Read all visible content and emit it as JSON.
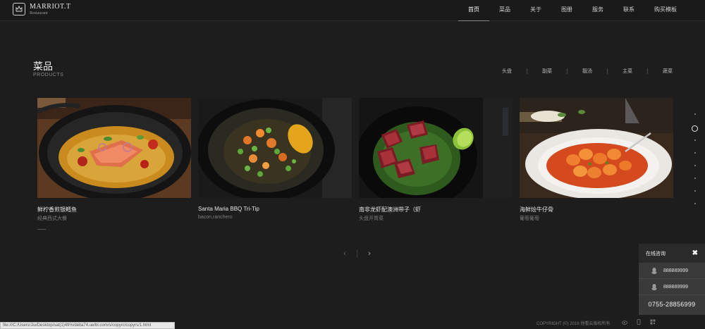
{
  "brand": {
    "name": "MARRIOT.T",
    "sub": "Restaurant"
  },
  "nav": [
    {
      "label": "首页",
      "active": true
    },
    {
      "label": "菜品"
    },
    {
      "label": "关于"
    },
    {
      "label": "图册"
    },
    {
      "label": "服务"
    },
    {
      "label": "联系"
    },
    {
      "label": "购买模板"
    }
  ],
  "section": {
    "title": "菜品",
    "subtitle": "PRODUCTS"
  },
  "filters": [
    "头盘",
    "副菜",
    "靓汤",
    "主菜",
    "蔬菜"
  ],
  "products": [
    {
      "name": "鲜柠香煎银鳕鱼",
      "desc": "经典西式大餐",
      "image": "salmon-skillet"
    },
    {
      "name": "Santa Maria BBQ Tri-Tip",
      "desc": "bacon,ranchero",
      "image": "vegetable-plate"
    },
    {
      "name": "南非龙虾配澳洲带子（虾",
      "desc": "头盘开胃菜",
      "image": "steak-plate"
    },
    {
      "name": "海鲜烩牛仔骨",
      "desc": "葡萄葡萄",
      "image": "gnocchi-bowl"
    }
  ],
  "pager": {
    "prev": "‹",
    "next": "›"
  },
  "online": {
    "title": "在线咨询",
    "close": "✖",
    "qq": [
      "888889999",
      "888889999"
    ],
    "phone": "0755-28856999"
  },
  "footer": {
    "copyright": "COPYRIGHT (©) 2016 他看云版权所有"
  },
  "statusbar": "file:///C:/Users/Jiu/Desktop/sat(1)49%/delta74.ue/bl.com/s/copyrc/copyrs/1.html",
  "colors": {
    "background": "#1d1d1d",
    "header": "#1a1a1a",
    "panel": "#3a3a3a"
  }
}
